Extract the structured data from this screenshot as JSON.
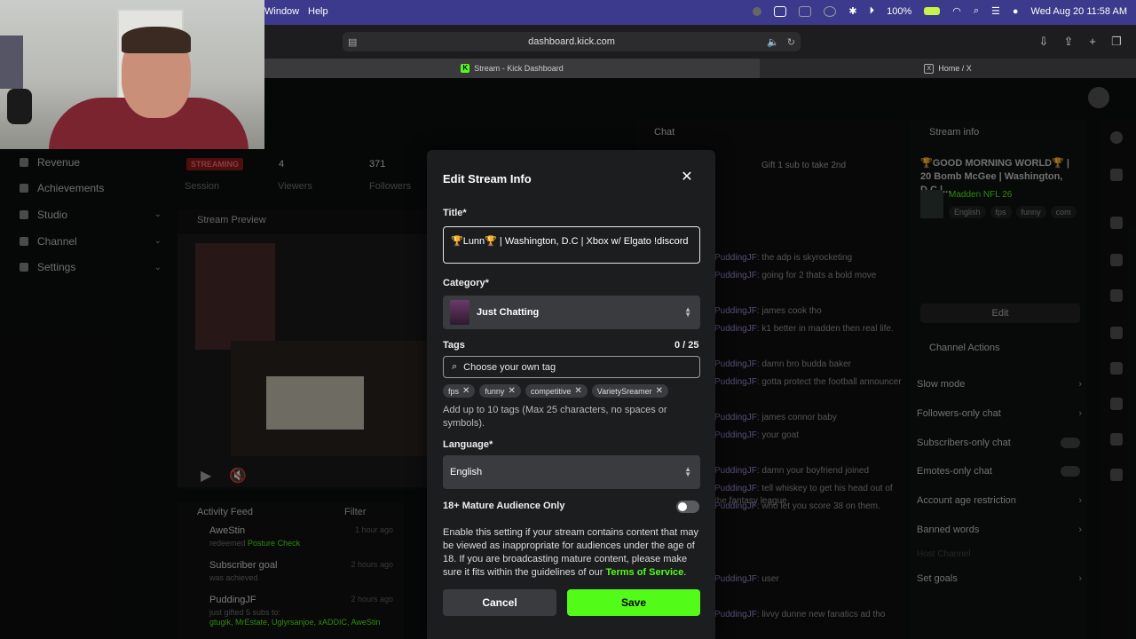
{
  "menubar": {
    "items": [
      "Window",
      "Help"
    ],
    "battery": "100%",
    "clock": "Wed Aug 20  11:58 AM"
  },
  "browser": {
    "url": "dashboard.kick.com",
    "tabs": [
      {
        "label": "Stream - Kick Dashboard"
      },
      {
        "label": "Home / X"
      }
    ]
  },
  "sidebar": {
    "items": [
      {
        "label": "Revenue"
      },
      {
        "label": "Achievements"
      },
      {
        "label": "Studio"
      },
      {
        "label": "Channel"
      },
      {
        "label": "Settings"
      }
    ]
  },
  "stats": {
    "badge": "STREAMING",
    "session_label": "Session",
    "viewers_value": "4",
    "viewers_label": "Viewers",
    "followers_value": "371",
    "followers_label": "Followers"
  },
  "preview": {
    "title": "Stream Preview"
  },
  "activity": {
    "title": "Activity Feed",
    "filter": "Filter",
    "rows": [
      {
        "name": "AweStin",
        "sub": "redeemed",
        "sub_extra": "Posture Check",
        "time": "1 hour ago"
      },
      {
        "name": "Subscriber goal",
        "sub": "was achieved",
        "time": "2 hours ago"
      },
      {
        "name": "PuddingJF",
        "sub": "just gifted 5 subs to:",
        "sub_extra": "gtugik, MrEstate, Uglyrsanjoe, xADDIC, AweStin",
        "time": "2 hours ago"
      }
    ]
  },
  "chat": {
    "title": "Chat",
    "pinned": "Gift 1 sub to take 2nd",
    "messages": [
      {
        "user": "PuddingJF",
        "text": ": the adp is skyrocketing"
      },
      {
        "user": "PuddingJF",
        "text": ": going for 2 thats a bold move"
      },
      {
        "user": "PuddingJF",
        "text": ": james cook tho"
      },
      {
        "user": "PuddingJF",
        "text": ": k1 better in madden then real life."
      },
      {
        "user": "PuddingJF",
        "text": ": damn bro budda baker"
      },
      {
        "user": "PuddingJF",
        "text": ": gotta protect the football announcer"
      },
      {
        "user": "PuddingJF",
        "text": ": james connor baby"
      },
      {
        "user": "PuddingJF",
        "text": ": your goat"
      },
      {
        "user": "PuddingJF",
        "text": ": damn your boyfriend joined"
      },
      {
        "user": "PuddingJF",
        "text": ": tell whiskey to get his head out of the fantasy league"
      },
      {
        "user": "PuddingJF",
        "text": ": who let you score 38 on them."
      },
      {
        "user": "PuddingJF",
        "text": ": user"
      },
      {
        "user": "PuddingJF",
        "text": ": livvy dunne new fanatics ad tho"
      }
    ]
  },
  "stream_info": {
    "title": "Stream info",
    "stream_title": "🏆GOOD MORNING WORLD🏆 | 20 Bomb McGee | Washington, D.C |...",
    "category": "Madden NFL 26",
    "tags": [
      "English",
      "fps",
      "funny",
      "com"
    ],
    "edit_label": "Edit"
  },
  "channel_actions": {
    "title": "Channel Actions",
    "items": [
      {
        "label": "Slow mode"
      },
      {
        "label": "Followers-only chat"
      },
      {
        "label": "Subscribers-only chat"
      },
      {
        "label": "Emotes-only chat"
      },
      {
        "label": "Account age restriction"
      },
      {
        "label": "Banned words"
      },
      {
        "label": "Host Channel"
      },
      {
        "label": "Set goals"
      }
    ]
  },
  "modal": {
    "title": "Edit Stream Info",
    "title_label": "Title*",
    "title_value": "🏆Lunn🏆 | Washington, D.C | Xbox w/ Elgato !discord",
    "category_label": "Category*",
    "category_value": "Just Chatting",
    "tags_label": "Tags",
    "tags_count": "0 / 25",
    "tag_placeholder": "Choose your own tag",
    "tags": [
      "fps",
      "funny",
      "competitive",
      "VarietySreamer"
    ],
    "tags_help": "Add up to 10 tags (Max 25 characters, no spaces or symbols).",
    "language_label": "Language*",
    "language_value": "English",
    "mature_label": "18+ Mature Audience Only",
    "mature_on": false,
    "mature_text": "Enable this setting if your stream contains content that may be viewed as inappropriate for audiences under the age of 18. If you are broadcasting mature content, please make sure it fits within the guidelines of our ",
    "tos_link": "Terms of Service",
    "tos_end": ".",
    "cancel_label": "Cancel",
    "save_label": "Save"
  },
  "colors": {
    "accent": "#53fc18",
    "modal_bg": "#1c1d1f",
    "menubar": "#3b3a8c"
  }
}
